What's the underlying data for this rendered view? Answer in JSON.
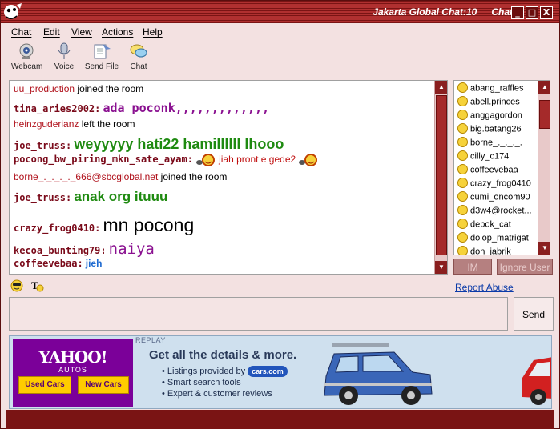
{
  "window": {
    "title": "Jakarta Global Chat:10",
    "title_suffix": "Chat",
    "minimize": "_",
    "maximize": "□",
    "close": "X"
  },
  "menu": [
    "Chat",
    "Edit",
    "View",
    "Actions",
    "Help"
  ],
  "toolbar": {
    "webcam": "Webcam",
    "voice": "Voice",
    "send_file": "Send File",
    "chat": "Chat"
  },
  "messages": [
    {
      "type": "system",
      "user": "uu_production",
      "text": " joined the room"
    },
    {
      "type": "chat",
      "nick": "tina_aries2002:",
      "text": "ada poconk,,,,,,,,,,,,,"
    },
    {
      "type": "system",
      "user": "heinzguderianz",
      "text": " left the room"
    },
    {
      "type": "chat",
      "nick": "joe_truss:",
      "text": "weyyyyy hati22 hamillllll lhooo"
    },
    {
      "type": "chat",
      "nick": "pocong_bw_piring_mkn_sate_ayam:",
      "text": "jiah pront e gede2"
    },
    {
      "type": "system",
      "user": "borne_._._._._666@sbcglobal.net",
      "text": " joined the room"
    },
    {
      "type": "chat",
      "nick": "joe_truss:",
      "text": "anak org ituuu"
    },
    {
      "type": "chat",
      "nick": "crazy_frog0410:",
      "text": "mn pocong"
    },
    {
      "type": "chat",
      "nick": "kecoa_bunting79:",
      "text": "naiya"
    },
    {
      "type": "chat",
      "nick": "coffeevebaa:",
      "text": "jieh"
    }
  ],
  "users": [
    "abang_raffles",
    "abell.princes",
    "anggagordon",
    "big.batang26",
    "borne_._._._.",
    "cilly_c174",
    "coffeevebaa",
    "crazy_frog0410",
    "cumi_oncom90",
    "d3w4@rocket...",
    "depok_cat",
    "dolop_matrigat",
    "don_jabrik"
  ],
  "buttons": {
    "im": "IM",
    "ignore_user": "Ignore User",
    "report_abuse": "Report Abuse",
    "send": "Send"
  },
  "input": {
    "value": ""
  },
  "ad": {
    "brand": "YAHOO!",
    "sub": "AUTOS",
    "used_cars": "Used Cars",
    "new_cars": "New Cars",
    "replay": "REPLAY",
    "headline": "Get all the details & more.",
    "bullet1_pre": "• Listings provided by",
    "bullet1_brand": "cars.com",
    "bullet2": "• Smart search tools",
    "bullet3": "• Expert & customer reviews"
  },
  "colors": {
    "accent": "#7a1414",
    "nick": "#7a0a1a",
    "msg_purple": "#8a1090",
    "msg_green": "#1e8a10",
    "msg_black": "#000000",
    "msg_red": "#c01010",
    "msg_blue": "#1e6ad0",
    "link": "#0a3aa8"
  }
}
